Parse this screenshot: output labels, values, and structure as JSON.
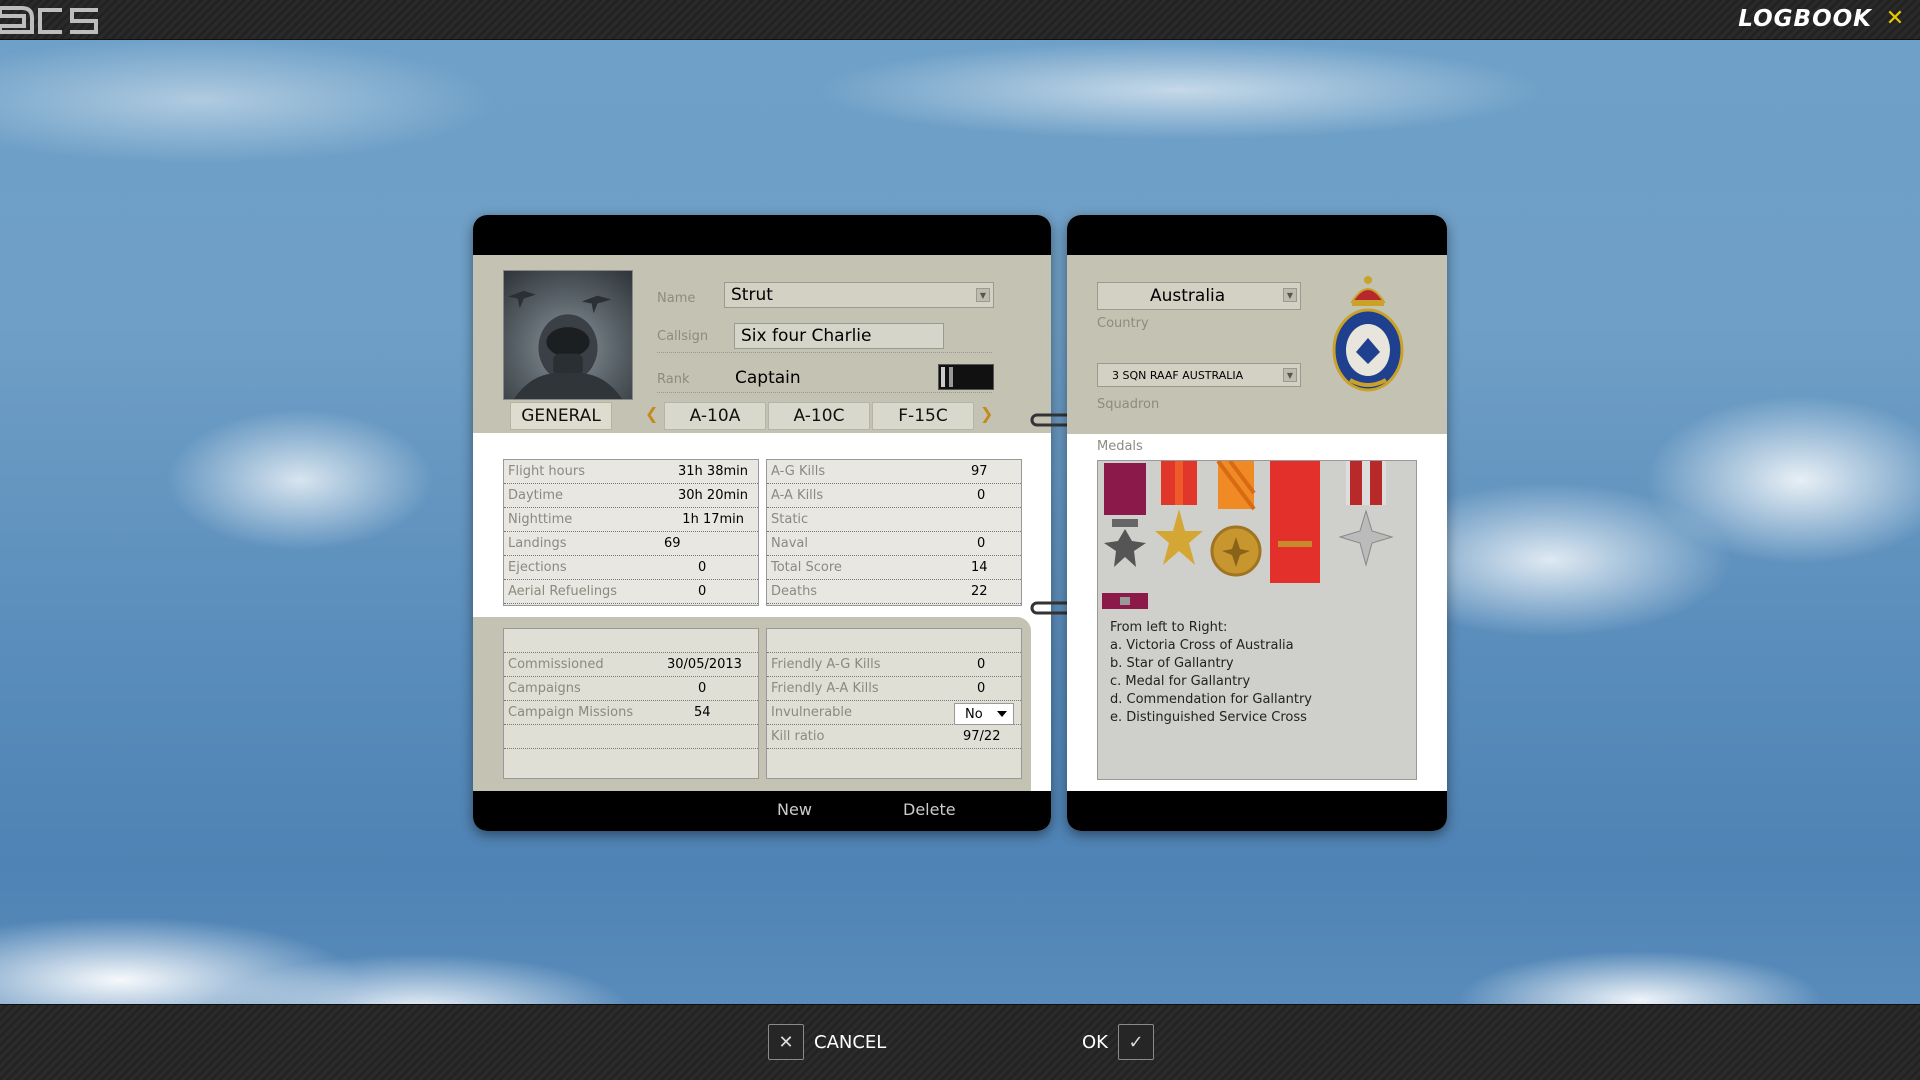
{
  "window": {
    "title": "LOGBOOK",
    "close_icon": "close-icon",
    "accent_color": "#e8c800"
  },
  "pilot": {
    "name_label": "Name",
    "name_value": "Strut",
    "callsign_label": "Callsign",
    "callsign_value": "Six four Charlie",
    "rank_label": "Rank",
    "rank_value": "Captain"
  },
  "tabs": [
    {
      "label": "GENERAL"
    },
    {
      "label": "A-10A"
    },
    {
      "label": "A-10C"
    },
    {
      "label": "F-15C"
    }
  ],
  "stats_left": [
    {
      "label": "Flight hours",
      "value": "31h 38min"
    },
    {
      "label": "Daytime",
      "value": "30h 20min"
    },
    {
      "label": "Nighttime",
      "value": "1h 17min"
    },
    {
      "label": "Landings",
      "value": "69"
    },
    {
      "label": "Ejections",
      "value": "0"
    },
    {
      "label": "Aerial Refuelings",
      "value": "0"
    }
  ],
  "stats_right": [
    {
      "label": "A-G Kills",
      "value": "97"
    },
    {
      "label": "A-A Kills",
      "value": "0"
    },
    {
      "label": "Static",
      "value": ""
    },
    {
      "label": "Naval",
      "value": "0"
    },
    {
      "label": "Total Score",
      "value": "14"
    },
    {
      "label": "Deaths",
      "value": "22"
    }
  ],
  "career_left": [
    {
      "label": "Commissioned",
      "value": "30/05/2013"
    },
    {
      "label": "Campaigns",
      "value": "0"
    },
    {
      "label": "Campaign Missions",
      "value": "54"
    }
  ],
  "career_right": [
    {
      "label": "Friendly A-G Kills",
      "value": "0"
    },
    {
      "label": "Friendly A-A Kills",
      "value": "0"
    },
    {
      "label": "Invulnerable",
      "value": "No"
    },
    {
      "label": "Kill ratio",
      "value": "97/22"
    }
  ],
  "footer_left": {
    "new_label": "New",
    "delete_label": "Delete"
  },
  "unit": {
    "country_value": "Australia",
    "country_label": "Country",
    "squadron_value": "3 SQN RAAF AUSTRALIA",
    "squadron_label": "Squadron"
  },
  "medals": {
    "label": "Medals",
    "description": [
      "From left to Right:",
      "a. Victoria Cross of Australia",
      "b. Star of Gallantry",
      "c. Medal for Gallantry",
      "d. Commendation for Gallantry",
      "e. Distinguished Service Cross"
    ]
  },
  "dialog": {
    "cancel_label": "CANCEL",
    "ok_label": "OK"
  }
}
